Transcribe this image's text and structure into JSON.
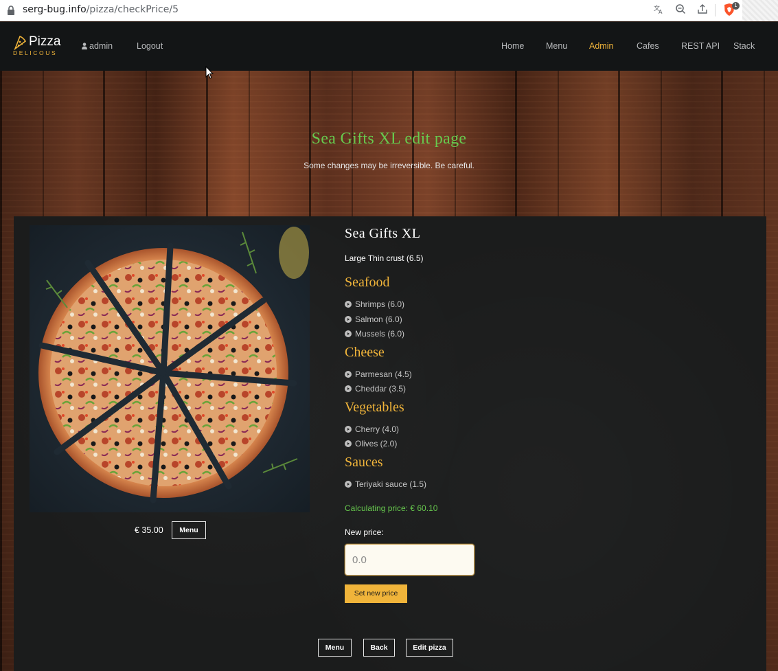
{
  "browser": {
    "url_host": "serg-bug.info",
    "url_path": "/pizza/checkPrice/5",
    "brave_badge": "1"
  },
  "nav": {
    "logo_word": "Pizza",
    "logo_sub": "DELICOUS",
    "user": "admin",
    "logout": "Logout",
    "items": [
      "Home",
      "Menu",
      "Admin",
      "Cafes",
      "REST API",
      "Stack"
    ],
    "active": "Admin",
    "accent_color": "#f0b43a"
  },
  "hero": {
    "title": "Sea Gifts XL edit page",
    "subtitle": "Some changes may be irreversible. Be careful."
  },
  "pizza": {
    "price": "€ 35.00",
    "menu_button": "Menu",
    "name": "Sea Gifts XL",
    "size": "Large Thin crust (6.5)",
    "categories": [
      {
        "name": "Seafood",
        "items": [
          "Shrimps (6.0)",
          "Salmon (6.0)",
          "Mussels (6.0)"
        ]
      },
      {
        "name": "Cheese",
        "items": [
          "Parmesan (4.5)",
          "Cheddar (3.5)"
        ]
      },
      {
        "name": "Vegetables",
        "items": [
          "Cherry (4.0)",
          "Olives (2.0)"
        ]
      },
      {
        "name": "Sauces",
        "items": [
          "Teriyaki sauce (1.5)"
        ]
      }
    ],
    "calculating_price": "Calculating price: € 60.10",
    "new_price_label": "New price:",
    "new_price_placeholder": "0.0",
    "set_button": "Set new price"
  },
  "footer_buttons": [
    "Menu",
    "Back",
    "Edit pizza"
  ],
  "colors": {
    "green": "#67c94e",
    "gold": "#f0b43a",
    "chalkboard": "#1b1c1c",
    "navbar": "#131516"
  }
}
